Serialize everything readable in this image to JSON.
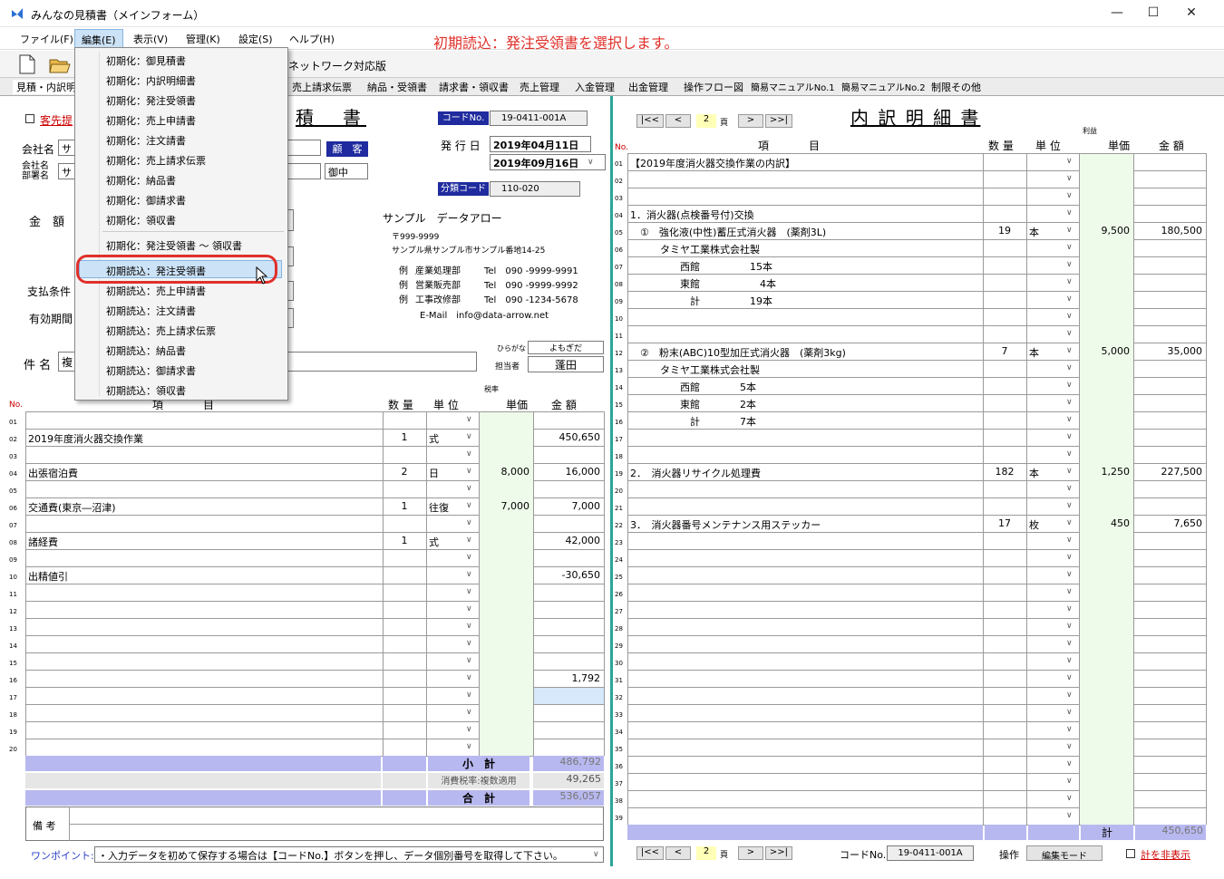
{
  "window": {
    "title": "みんなの見積書（メインフォーム）",
    "min": "—",
    "max": "☐",
    "close": "✕"
  },
  "annotation": "初期読込：発注受領書を選択します。",
  "menus": [
    "ファイル(F)",
    "編集(E)",
    "表示(V)",
    "管理(K)",
    "設定(S)",
    "ヘルプ(H)"
  ],
  "network_label": "ネットワーク対応版",
  "tabs": [
    "見積・内訳明",
    "売上請求伝票",
    "納品・受領書",
    "請求書・領収書",
    "売上管理",
    "入金管理",
    "出金管理",
    "操作フロー図",
    "簡易マニュアルNo.1",
    "簡易マニュアルNo.2",
    "制限その他"
  ],
  "edit_menu": {
    "items": [
      "初期化：御見積書",
      "初期化：内訳明細書",
      "初期化：発注受領書",
      "初期化：売上申請書",
      "初期化：注文請書",
      "初期化：売上請求伝票",
      "初期化：納品書",
      "初期化：御請求書",
      "初期化：領収書",
      "初期化：発注受領書 ～ 領収書",
      "初期読込：発注受領書",
      "初期読込：売上申請書",
      "初期読込：注文請書",
      "初期読込：売上請求伝票",
      "初期読込：納品書",
      "初期読込：御請求書",
      "初期読込：領収書"
    ]
  },
  "estimate": {
    "customer_check": "客先提",
    "title": "積　書",
    "code_label": "コードNo.",
    "code_value": "19-0411-001A",
    "issue_label": "発 行 日",
    "issue_date": "2019年04月11日",
    "due_date": "2019年09月16日",
    "class_label": "分類コード",
    "class_value": "110-020",
    "company_label": "会社名",
    "company_value": "サ",
    "dept_label": "会社名\n部署名",
    "dept_value": "サ",
    "customer_btn": "顧　客",
    "honorific": "御中",
    "amount_label": "金　額",
    "payment_label": "支払条件",
    "validity_label": "有効期間",
    "subject_label": "件 名",
    "subject_value": "複",
    "sender": {
      "name": "サンプル　データアロー",
      "zip": "〒999-9999",
      "address": "サンプル県サンプル市サンプル番地14-25",
      "lines": [
        {
          "ex": "例",
          "dept": "産業処理部",
          "tel": "Tel　090 -9999-9991"
        },
        {
          "ex": "例",
          "dept": "営業販売部",
          "tel": "Tel　090 -9999-9992"
        },
        {
          "ex": "例",
          "dept": "工事改修部",
          "tel": "Tel　090 -1234-5678"
        }
      ],
      "email": "E-Mail　info@data-arrow.net"
    },
    "furigana_label": "ひらがな",
    "furigana": "よもぎだ",
    "staff_label": "担当者",
    "staff": "蓬田",
    "headers": {
      "no": "No.",
      "item": "項　　　目",
      "qty": "数 量",
      "unit": "単 位",
      "taxrate": "税率",
      "price": "単価",
      "amount": "金 額"
    },
    "rows": [
      {
        "n": "01",
        "item": "",
        "qty": "",
        "unit": "",
        "price": "",
        "amount": ""
      },
      {
        "n": "02",
        "item": "2019年度消火器交換作業",
        "qty": "1",
        "unit": "式",
        "price": "",
        "amount": "450,650"
      },
      {
        "n": "03",
        "item": "",
        "qty": "",
        "unit": "",
        "price": "",
        "amount": ""
      },
      {
        "n": "04",
        "item": "出張宿泊費",
        "qty": "2",
        "unit": "日",
        "price": "8,000",
        "amount": "16,000"
      },
      {
        "n": "05",
        "item": "",
        "qty": "",
        "unit": "",
        "price": "",
        "amount": ""
      },
      {
        "n": "06",
        "item": "交通費(東京―沼津)",
        "qty": "1",
        "unit": "往復",
        "price": "7,000",
        "amount": "7,000"
      },
      {
        "n": "07",
        "item": "",
        "qty": "",
        "unit": "",
        "price": "",
        "amount": ""
      },
      {
        "n": "08",
        "item": "諸経費",
        "qty": "1",
        "unit": "式",
        "price": "",
        "amount": "42,000"
      },
      {
        "n": "09",
        "item": "",
        "qty": "",
        "unit": "",
        "price": "",
        "amount": ""
      },
      {
        "n": "10",
        "item": "出精値引",
        "qty": "",
        "unit": "",
        "price": "",
        "amount": "-30,650"
      },
      {
        "n": "11",
        "item": "",
        "qty": "",
        "unit": "",
        "price": "",
        "amount": ""
      },
      {
        "n": "12",
        "item": "",
        "qty": "",
        "unit": "",
        "price": "",
        "amount": ""
      },
      {
        "n": "13",
        "item": "",
        "qty": "",
        "unit": "",
        "price": "",
        "amount": ""
      },
      {
        "n": "14",
        "item": "",
        "qty": "",
        "unit": "",
        "price": "",
        "amount": ""
      },
      {
        "n": "15",
        "item": "",
        "qty": "",
        "unit": "",
        "price": "",
        "amount": ""
      },
      {
        "n": "16",
        "item": "",
        "qty": "",
        "unit": "",
        "price": "",
        "amount": "1,792"
      },
      {
        "n": "17",
        "item": "",
        "qty": "",
        "unit": "",
        "price": "",
        "amount": ""
      },
      {
        "n": "18",
        "item": "",
        "qty": "",
        "unit": "",
        "price": "",
        "amount": ""
      },
      {
        "n": "19",
        "item": "",
        "qty": "",
        "unit": "",
        "price": "",
        "amount": ""
      },
      {
        "n": "20",
        "item": "",
        "qty": "",
        "unit": "",
        "price": "",
        "amount": ""
      }
    ],
    "subtotal_label": "小　計",
    "subtotal": "486,792",
    "tax_label": "消費税率:複数適用",
    "tax": "49,265",
    "total_label": "合　計",
    "total": "536,057",
    "remarks_label": "備 考",
    "tip_label": "ワンポイント:",
    "tip": "・入力データを初めて保存する場合は【コードNo.】ボタンを押し、データ個別番号を取得して下さい。"
  },
  "breakdown": {
    "title": "内 訳 明 細 書",
    "nav": [
      "|<<",
      "<",
      "2",
      "頁",
      ">",
      ">>|"
    ],
    "headers": {
      "no": "No.",
      "item": "項　　　目",
      "qty": "数 量",
      "unit": "単 位",
      "profit": "利益",
      "price": "単価",
      "amount": "金 額"
    },
    "rows": [
      {
        "n": "01",
        "item": "【2019年度消火器交換作業の内訳】",
        "qty": "",
        "unit": "",
        "price": "",
        "amount": ""
      },
      {
        "n": "02",
        "item": "",
        "qty": "",
        "unit": "",
        "price": "",
        "amount": ""
      },
      {
        "n": "03",
        "item": "",
        "qty": "",
        "unit": "",
        "price": "",
        "amount": ""
      },
      {
        "n": "04",
        "item": "1．消火器(点検番号付)交換",
        "qty": "",
        "unit": "",
        "price": "",
        "amount": ""
      },
      {
        "n": "05",
        "item": "　①　強化液(中性)蓄圧式消火器　(薬剤3L)",
        "qty": "19",
        "unit": "本",
        "price": "9,500",
        "amount": "180,500"
      },
      {
        "n": "06",
        "item": "　　　タミヤ工業株式会社製",
        "qty": "",
        "unit": "",
        "price": "",
        "amount": ""
      },
      {
        "n": "07",
        "item": "　　　　　西館　　　　　15本",
        "qty": "",
        "unit": "",
        "price": "",
        "amount": ""
      },
      {
        "n": "08",
        "item": "　　　　　東館　　　　　　4本",
        "qty": "",
        "unit": "",
        "price": "",
        "amount": ""
      },
      {
        "n": "09",
        "item": "　　　　　　計　　　　　19本",
        "qty": "",
        "unit": "",
        "price": "",
        "amount": ""
      },
      {
        "n": "10",
        "item": "",
        "qty": "",
        "unit": "",
        "price": "",
        "amount": ""
      },
      {
        "n": "11",
        "item": "",
        "qty": "",
        "unit": "",
        "price": "",
        "amount": ""
      },
      {
        "n": "12",
        "item": "　②　粉末(ABC)10型加圧式消火器　(薬剤3kg)",
        "qty": "7",
        "unit": "本",
        "price": "5,000",
        "amount": "35,000"
      },
      {
        "n": "13",
        "item": "　　　タミヤ工業株式会社製",
        "qty": "",
        "unit": "",
        "price": "",
        "amount": ""
      },
      {
        "n": "14",
        "item": "　　　　　西館　　　　5本",
        "qty": "",
        "unit": "",
        "price": "",
        "amount": ""
      },
      {
        "n": "15",
        "item": "　　　　　東館　　　　2本",
        "qty": "",
        "unit": "",
        "price": "",
        "amount": ""
      },
      {
        "n": "16",
        "item": "　　　　　　計　　　　7本",
        "qty": "",
        "unit": "",
        "price": "",
        "amount": ""
      },
      {
        "n": "17",
        "item": "",
        "qty": "",
        "unit": "",
        "price": "",
        "amount": ""
      },
      {
        "n": "18",
        "item": "",
        "qty": "",
        "unit": "",
        "price": "",
        "amount": ""
      },
      {
        "n": "19",
        "item": "2．　消火器リサイクル処理費",
        "qty": "182",
        "unit": "本",
        "price": "1,250",
        "amount": "227,500"
      },
      {
        "n": "20",
        "item": "",
        "qty": "",
        "unit": "",
        "price": "",
        "amount": ""
      },
      {
        "n": "21",
        "item": "",
        "qty": "",
        "unit": "",
        "price": "",
        "amount": ""
      },
      {
        "n": "22",
        "item": "3．　消火器番号メンテナンス用ステッカー",
        "qty": "17",
        "unit": "枚",
        "price": "450",
        "amount": "7,650"
      },
      {
        "n": "23",
        "item": "",
        "qty": "",
        "unit": "",
        "price": "",
        "amount": ""
      },
      {
        "n": "24",
        "item": "",
        "qty": "",
        "unit": "",
        "price": "",
        "amount": ""
      },
      {
        "n": "25",
        "item": "",
        "qty": "",
        "unit": "",
        "price": "",
        "amount": ""
      },
      {
        "n": "26",
        "item": "",
        "qty": "",
        "unit": "",
        "price": "",
        "amount": ""
      },
      {
        "n": "27",
        "item": "",
        "qty": "",
        "unit": "",
        "price": "",
        "amount": ""
      },
      {
        "n": "28",
        "item": "",
        "qty": "",
        "unit": "",
        "price": "",
        "amount": ""
      },
      {
        "n": "29",
        "item": "",
        "qty": "",
        "unit": "",
        "price": "",
        "amount": ""
      },
      {
        "n": "30",
        "item": "",
        "qty": "",
        "unit": "",
        "price": "",
        "amount": ""
      },
      {
        "n": "31",
        "item": "",
        "qty": "",
        "unit": "",
        "price": "",
        "amount": ""
      },
      {
        "n": "32",
        "item": "",
        "qty": "",
        "unit": "",
        "price": "",
        "amount": ""
      },
      {
        "n": "33",
        "item": "",
        "qty": "",
        "unit": "",
        "price": "",
        "amount": ""
      },
      {
        "n": "34",
        "item": "",
        "qty": "",
        "unit": "",
        "price": "",
        "amount": ""
      },
      {
        "n": "35",
        "item": "",
        "qty": "",
        "unit": "",
        "price": "",
        "amount": ""
      },
      {
        "n": "36",
        "item": "",
        "qty": "",
        "unit": "",
        "price": "",
        "amount": ""
      },
      {
        "n": "37",
        "item": "",
        "qty": "",
        "unit": "",
        "price": "",
        "amount": ""
      },
      {
        "n": "38",
        "item": "",
        "qty": "",
        "unit": "",
        "price": "",
        "amount": ""
      },
      {
        "n": "39",
        "item": "",
        "qty": "",
        "unit": "",
        "price": "",
        "amount": ""
      }
    ],
    "total_label": "計",
    "total": "450,650",
    "footer": {
      "code_label": "コードNo.",
      "code": "19-0411-001A",
      "op_label": "操作",
      "mode": "編集モード",
      "hide_total": "計を非表示"
    }
  },
  "colors": {
    "navy": "#1f2b9e",
    "accent_red": "#e0302a",
    "teal": "#2aa59a",
    "sum_blue": "#b8b8f0",
    "price_green": "#eefaea"
  }
}
